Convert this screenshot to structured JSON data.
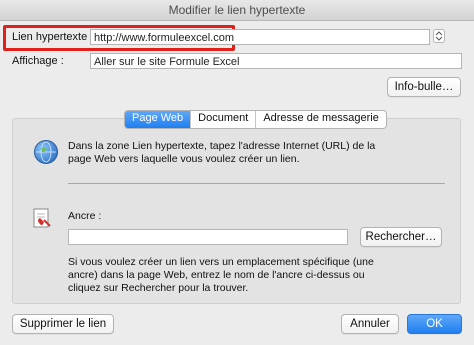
{
  "window": {
    "title": "Modifier le lien hypertexte"
  },
  "link": {
    "label": "Lien hypertexte :",
    "value": "http://www.formuleexcel.com"
  },
  "display": {
    "label": "Affichage :",
    "value": "Aller sur le site Formule Excel"
  },
  "buttons": {
    "tooltip": "Info-bulle…",
    "search": "Rechercher…",
    "remove": "Supprimer le lien",
    "cancel": "Annuler",
    "ok": "OK"
  },
  "tabs": [
    {
      "label": "Page Web",
      "active": true
    },
    {
      "label": "Document",
      "active": false
    },
    {
      "label": "Adresse de messagerie",
      "active": false
    }
  ],
  "webpage": {
    "description_line1": "Dans la zone Lien hypertexte, tapez l'adresse Internet (URL) de la",
    "description_line2": "page Web vers laquelle vous voulez créer un lien.",
    "anchor_label": "Ancre :",
    "anchor_value": "",
    "help_line1": "Si vous voulez créer un lien vers un emplacement spécifique (une",
    "help_line2": "ancre) dans la page Web, entrez le nom de l'ancre ci-dessus ou",
    "help_line3": "cliquez sur Rechercher pour la trouver."
  },
  "colors": {
    "highlight": "#e0201b",
    "accent": "#1f7ff0"
  },
  "icons": {
    "globe": "globe-icon",
    "anchor": "anchor-link-icon",
    "stepper": "stepper-icon"
  }
}
